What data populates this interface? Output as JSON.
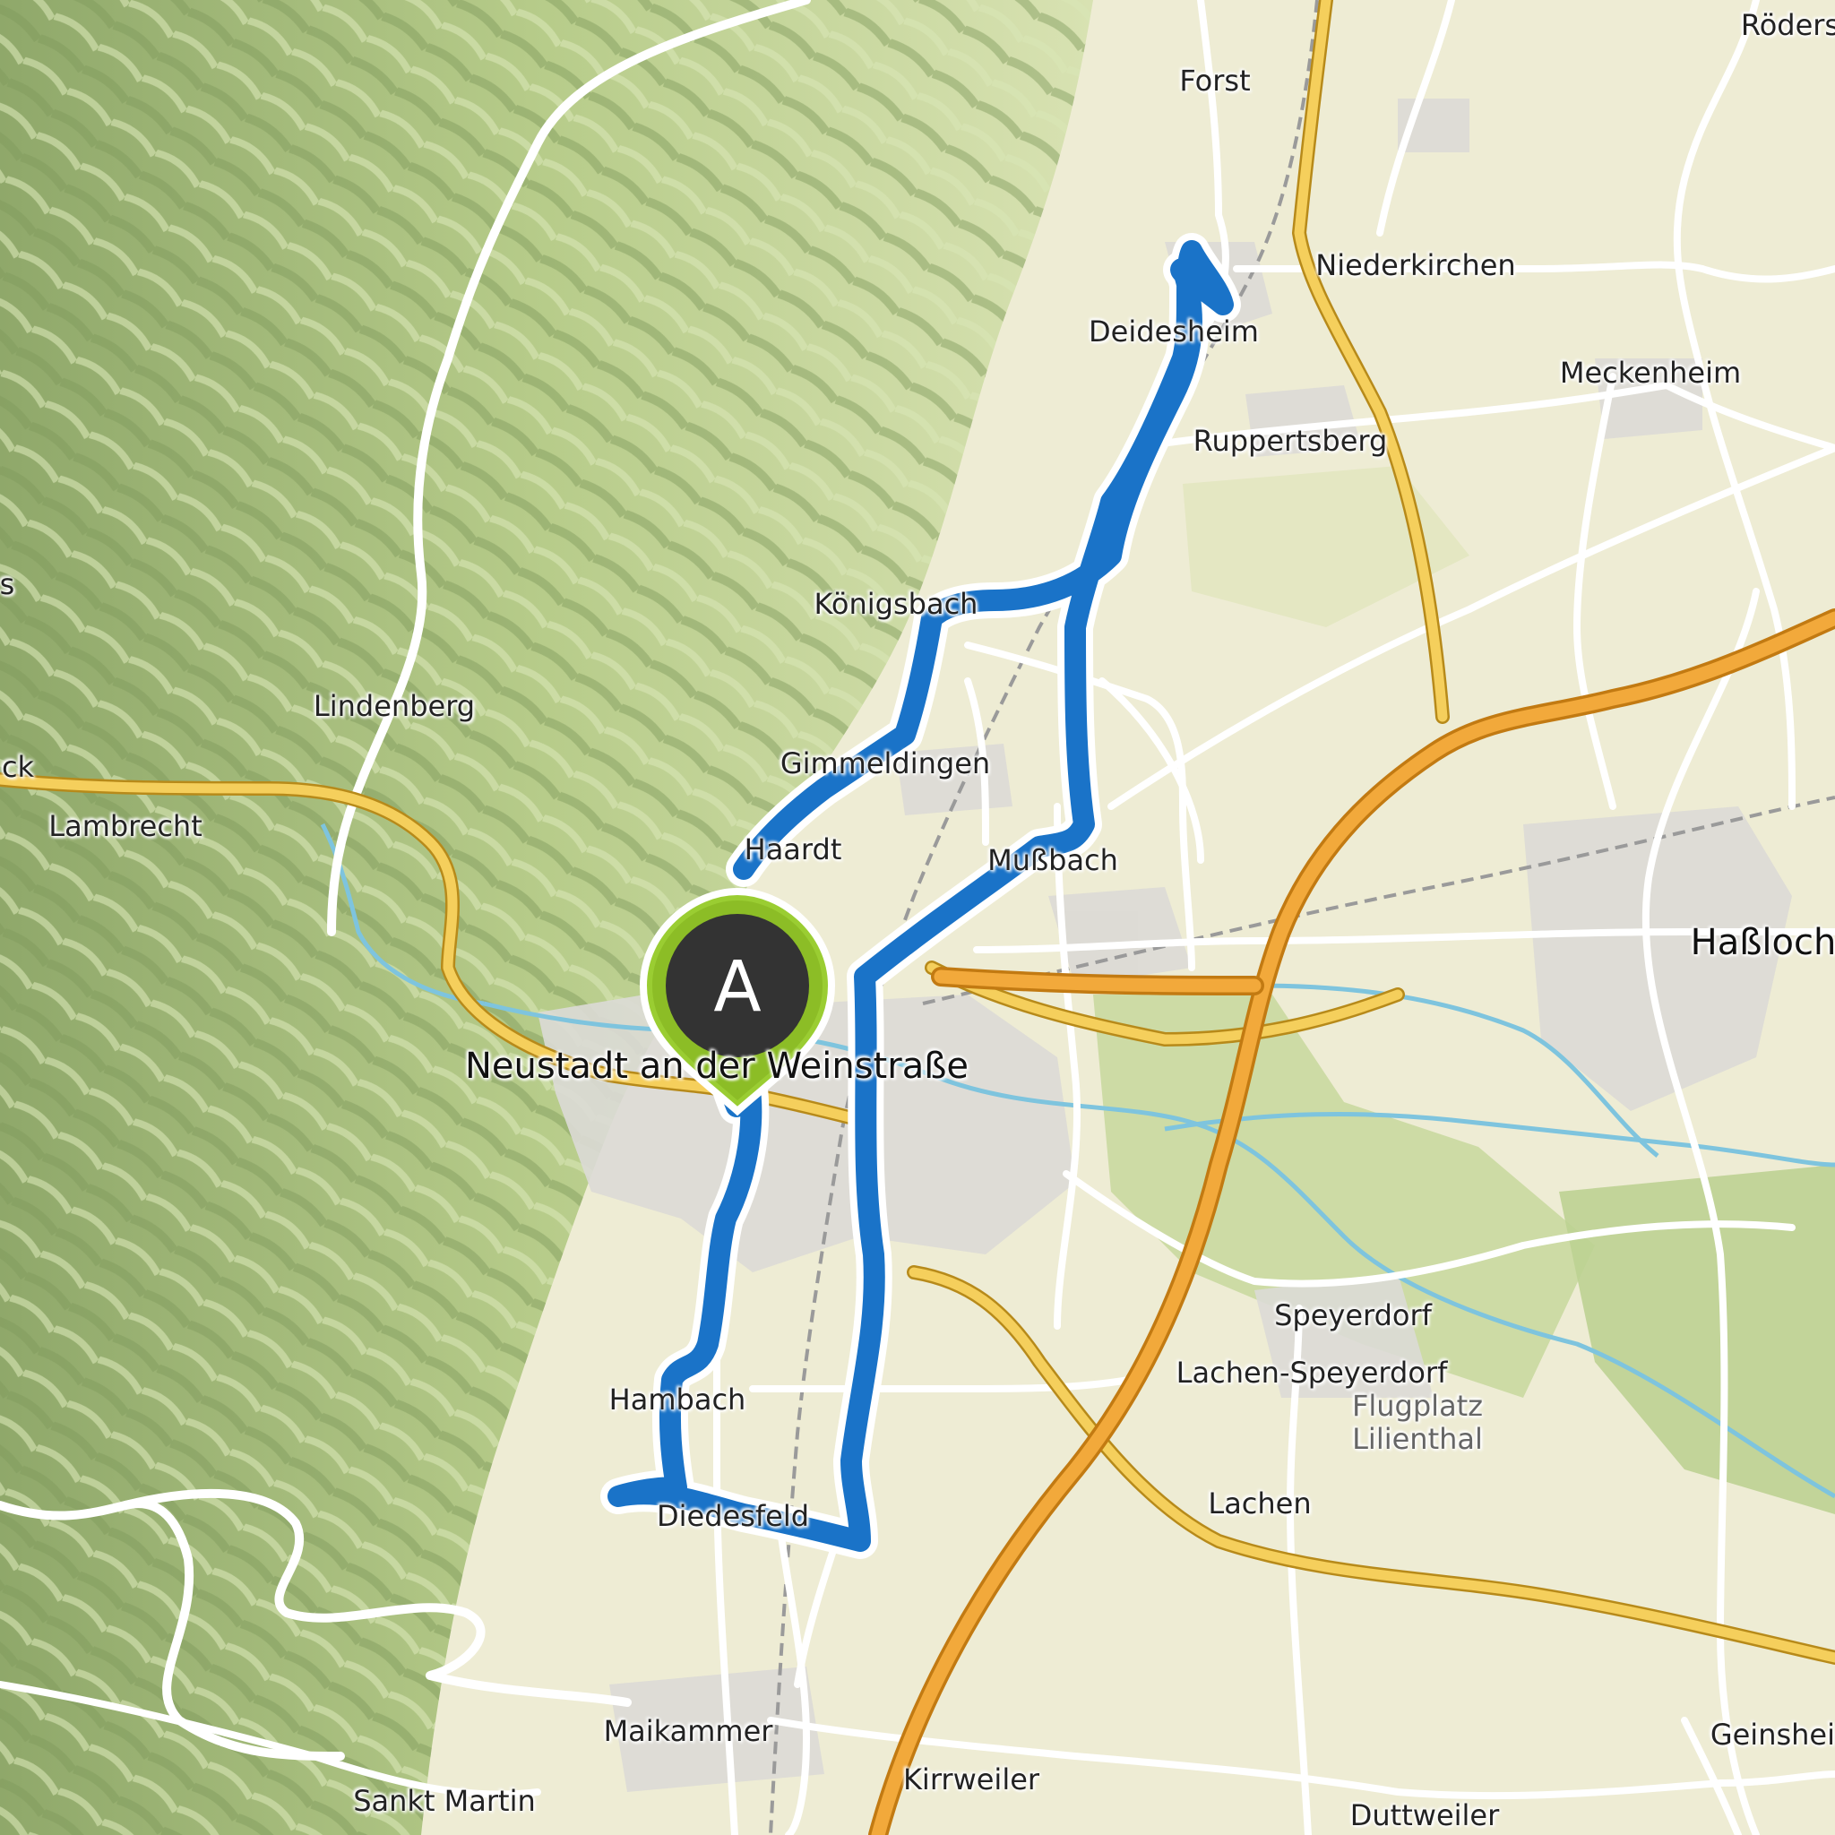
{
  "map": {
    "places": [
      {
        "id": "roedersheim",
        "label": "Röders"
      },
      {
        "id": "forst",
        "label": "Forst"
      },
      {
        "id": "niederkirchen",
        "label": "Niederkirchen"
      },
      {
        "id": "deidesheim",
        "label": "Deidesheim"
      },
      {
        "id": "meckenheim",
        "label": "Meckenheim"
      },
      {
        "id": "ruppertsberg",
        "label": "Ruppertsberg"
      },
      {
        "id": "koenigsbach",
        "label": "Königsbach"
      },
      {
        "id": "lindenberg",
        "label": "Lindenberg"
      },
      {
        "id": "gimmeldingen",
        "label": "Gimmeldingen"
      },
      {
        "id": "haardt",
        "label": "Haardt"
      },
      {
        "id": "mussbach",
        "label": "Mußbach"
      },
      {
        "id": "lambrecht",
        "label": "Lambrecht"
      },
      {
        "id": "hassloch",
        "label": "Haßloch"
      },
      {
        "id": "neustadt",
        "label": "Neustadt an der Weinstraße"
      },
      {
        "id": "speyerdorf",
        "label": "Speyerdorf"
      },
      {
        "id": "lachen-speyerdorf",
        "label": "Lachen-Speyerdorf"
      },
      {
        "id": "flugplatz",
        "label": "Flugplatz\nLilienthal"
      },
      {
        "id": "hambach",
        "label": "Hambach"
      },
      {
        "id": "lachen",
        "label": "Lachen"
      },
      {
        "id": "diedesfeld",
        "label": "Diedesfeld"
      },
      {
        "id": "maikammer",
        "label": "Maikammer"
      },
      {
        "id": "geinsheim",
        "label": "Geinsheim"
      },
      {
        "id": "kirrweiler",
        "label": "Kirrweiler"
      },
      {
        "id": "sankt-martin",
        "label": "Sankt Martin"
      },
      {
        "id": "duttweiler",
        "label": "Duttweiler"
      },
      {
        "id": "frankeneck-partial",
        "label": "ck"
      },
      {
        "id": "edge-partial",
        "label": "s"
      }
    ],
    "marker": {
      "letter": "A",
      "color": "#9acd32"
    },
    "route_color": "#1a73c8",
    "colors": {
      "forest": "#b9cf8e",
      "plain": "#eeecd4",
      "motorway": "#f2a93b",
      "main_road": "#f5cf5c",
      "road": "#ffffff",
      "river": "#7ec4de"
    }
  }
}
